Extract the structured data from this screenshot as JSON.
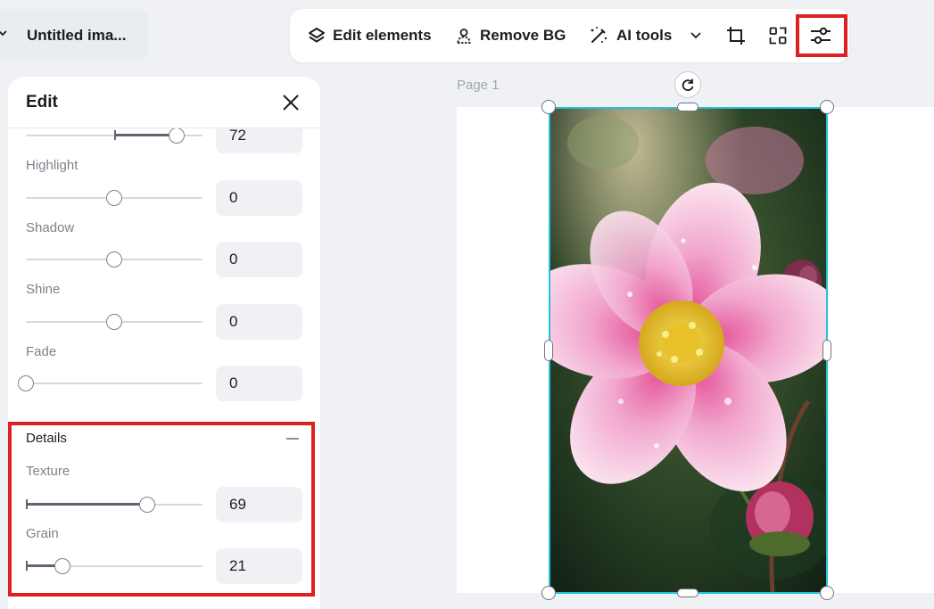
{
  "file": {
    "name": "Untitled ima..."
  },
  "toolbar": {
    "edit_elements_label": "Edit elements",
    "edit_elements_icon": "layers-icon",
    "remove_bg_label": "Remove BG",
    "remove_bg_icon": "person-outline-icon",
    "ai_tools_label": "AI tools",
    "ai_tools_icon": "magic-wand-icon",
    "buttons": [
      "crop-icon",
      "scan-icon",
      "adjust-sliders-icon"
    ],
    "highlight_color": "#e02020"
  },
  "panel": {
    "title": "Edit",
    "rows": [
      {
        "label": "",
        "value": "72"
      },
      {
        "label": "Highlight",
        "value": "0"
      },
      {
        "label": "Shadow",
        "value": "0"
      },
      {
        "label": "Shine",
        "value": "0"
      },
      {
        "label": "Fade",
        "value": "0"
      }
    ],
    "details": {
      "title": "Details",
      "rows": [
        {
          "label": "Texture",
          "value": "69"
        },
        {
          "label": "Grain",
          "value": "21"
        }
      ]
    }
  },
  "canvas": {
    "page_label": "Page 1",
    "image_subject": "pink-flower-photo",
    "selection_color": "#22c3d8"
  }
}
